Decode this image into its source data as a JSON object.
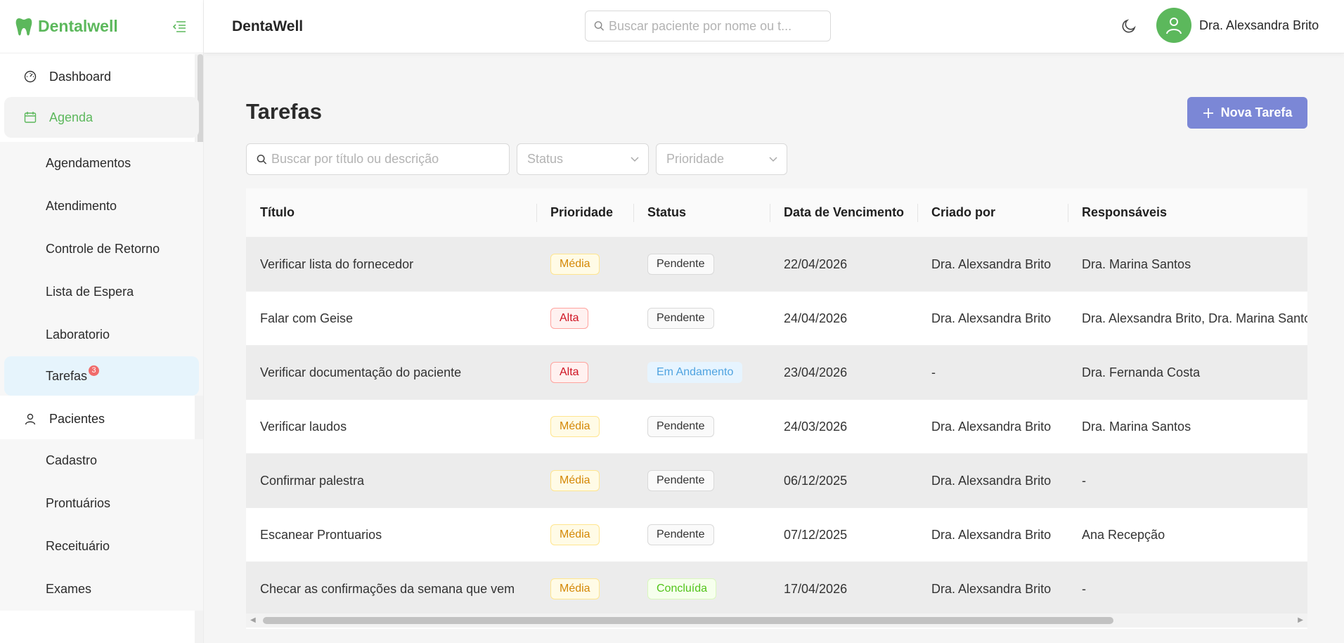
{
  "app": {
    "brand": "Dentalwell",
    "header_title": "DentaWell",
    "user_name": "Dra. Alexsandra Brito"
  },
  "header": {
    "search_placeholder": "Buscar paciente por nome ou t..."
  },
  "sidebar": {
    "dashboard": "Dashboard",
    "agenda": "Agenda",
    "agenda_items": [
      "Agendamentos",
      "Atendimento",
      "Controle de Retorno",
      "Lista de Espera",
      "Laboratorio"
    ],
    "tarefas": "Tarefas",
    "tarefas_badge": "3",
    "pacientes": "Pacientes",
    "pacientes_items": [
      "Cadastro",
      "Prontuários",
      "Receituário",
      "Exames"
    ]
  },
  "page": {
    "title": "Tarefas",
    "new_button": "Nova Tarefa",
    "search_placeholder": "Buscar por título ou descrição",
    "status_placeholder": "Status",
    "priority_placeholder": "Prioridade"
  },
  "table": {
    "columns": [
      "Título",
      "Prioridade",
      "Status",
      "Data de Vencimento",
      "Criado por",
      "Responsáveis"
    ],
    "rows": [
      [
        "Verificar lista do fornecedor",
        "Média",
        "Pendente",
        "22/04/2026",
        "Dra. Alexsandra Brito",
        "Dra. Marina Santos"
      ],
      [
        "Falar com Geise",
        "Alta",
        "Pendente",
        "24/04/2026",
        "Dra. Alexsandra Brito",
        "Dra. Alexsandra Brito, Dra. Marina Santos"
      ],
      [
        "Verificar documentação do paciente",
        "Alta",
        "Em Andamento",
        "23/04/2026",
        "-",
        "Dra. Fernanda Costa"
      ],
      [
        "Verificar laudos",
        "Média",
        "Pendente",
        "24/03/2026",
        "Dra. Alexsandra Brito",
        "Dra. Marina Santos"
      ],
      [
        "Confirmar palestra",
        "Média",
        "Pendente",
        "06/12/2025",
        "Dra. Alexsandra Brito",
        "-"
      ],
      [
        "Escanear Prontuarios",
        "Média",
        "Pendente",
        "07/12/2025",
        "Dra. Alexsandra Brito",
        "Ana Recepção"
      ],
      [
        "Checar as confirmações da semana que vem",
        "Média",
        "Concluída",
        "17/04/2026",
        "Dra. Alexsandra Brito",
        "-"
      ]
    ]
  },
  "colors": {
    "brand_green": "#5cb85c",
    "primary_button": "#7b87d6"
  }
}
